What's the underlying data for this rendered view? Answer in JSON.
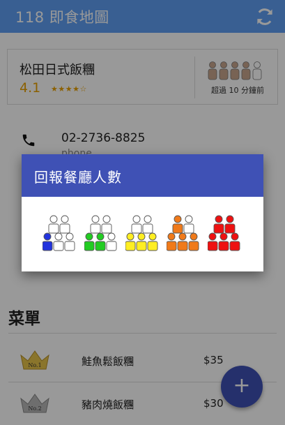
{
  "app": {
    "title": "118 即食地圖"
  },
  "restaurant": {
    "name": "松田日式飯糰",
    "rating": "4.1",
    "stars": "★★★★☆",
    "crowd_time": "超過 10 分鐘前"
  },
  "contact": {
    "phone": "02-2736-8825",
    "phone_label": "phone"
  },
  "menu": {
    "title": "菜單",
    "items": [
      {
        "rank": "No.1",
        "name": "鮭魚鬆飯糰",
        "price": "$35"
      },
      {
        "rank": "No.2",
        "name": "豬肉燒飯糰",
        "price": "$30"
      }
    ]
  },
  "fab": {
    "label": "+"
  },
  "dialog": {
    "title": "回報餐廳人數",
    "options": [
      {
        "level": 1,
        "color": "#2233dd"
      },
      {
        "level": 2,
        "color": "#22cc22"
      },
      {
        "level": 3,
        "color": "#ffee22"
      },
      {
        "level": 4,
        "color": "#f07a1a"
      },
      {
        "level": 5,
        "color": "#ee1111"
      }
    ]
  },
  "colors": {
    "appbar": "#5f9ff4",
    "primary": "#3f51b5",
    "rating": "#e8a000",
    "crowd_icon": "#c8a58c"
  }
}
